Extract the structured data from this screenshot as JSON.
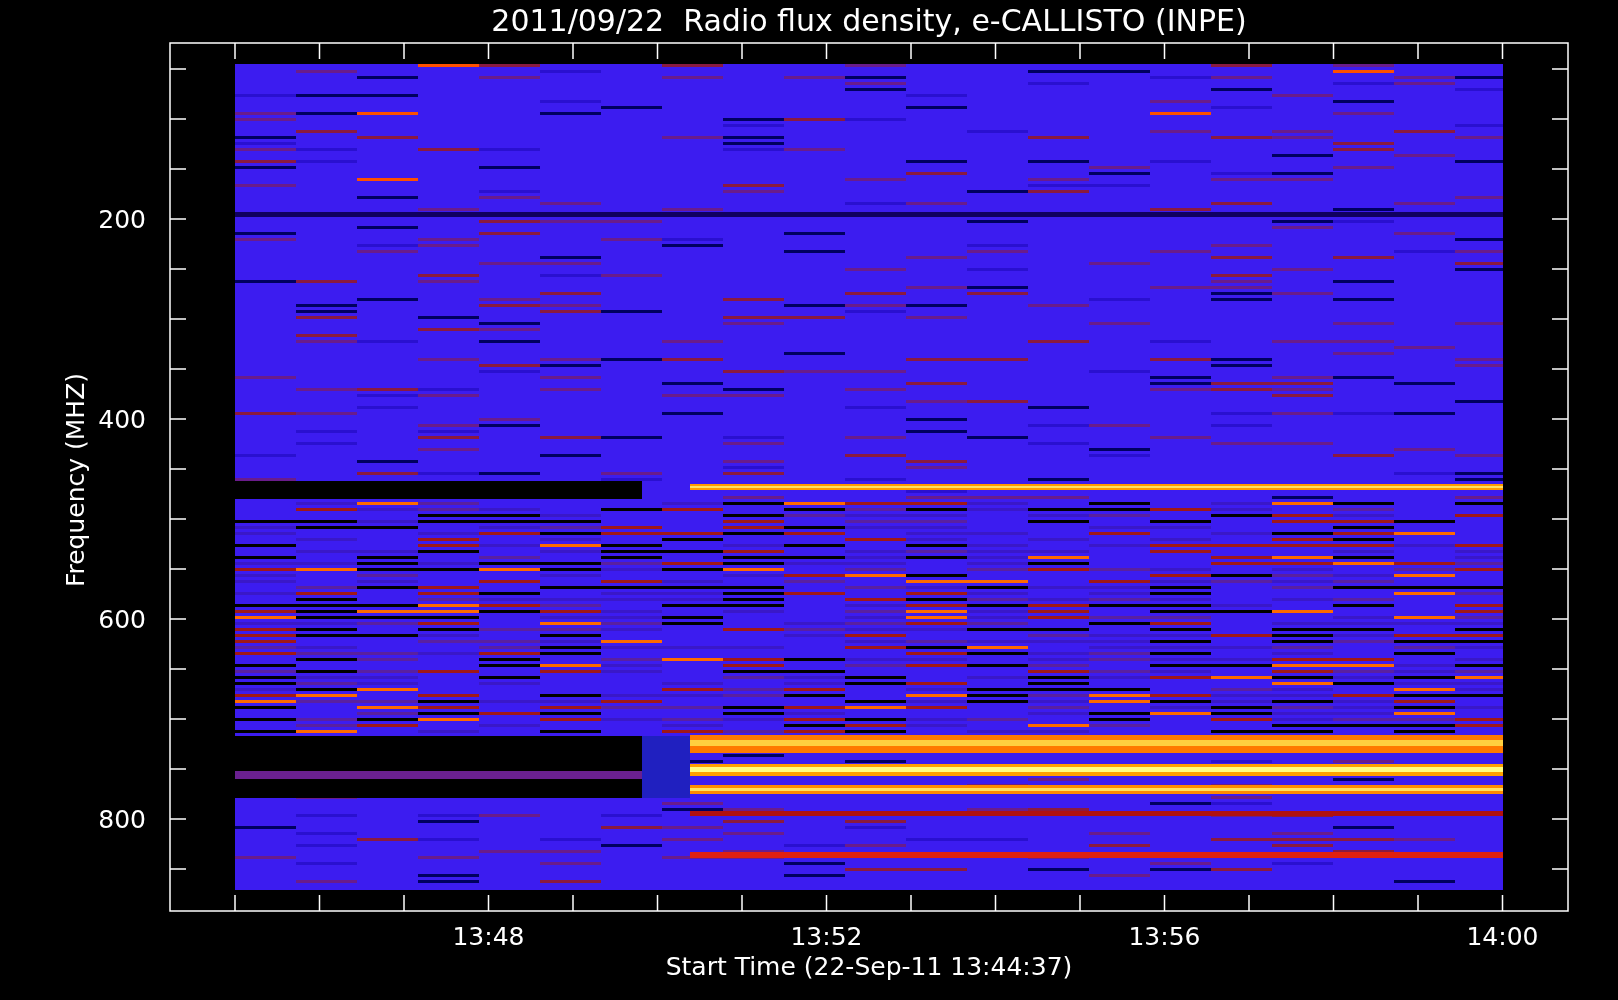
{
  "plot": {
    "title": "2011/09/22  Radio flux density, e-CALLISTO (INPE)",
    "y_axis": {
      "label": "Frequency (MHZ)",
      "tick_labels": [
        "200",
        "400",
        "600",
        "800"
      ]
    },
    "x_axis": {
      "label": "Start Time (22-Sep-11 13:44:37)",
      "tick_labels": [
        "13:48",
        "13:52",
        "13:56",
        "14:00"
      ]
    }
  }
}
